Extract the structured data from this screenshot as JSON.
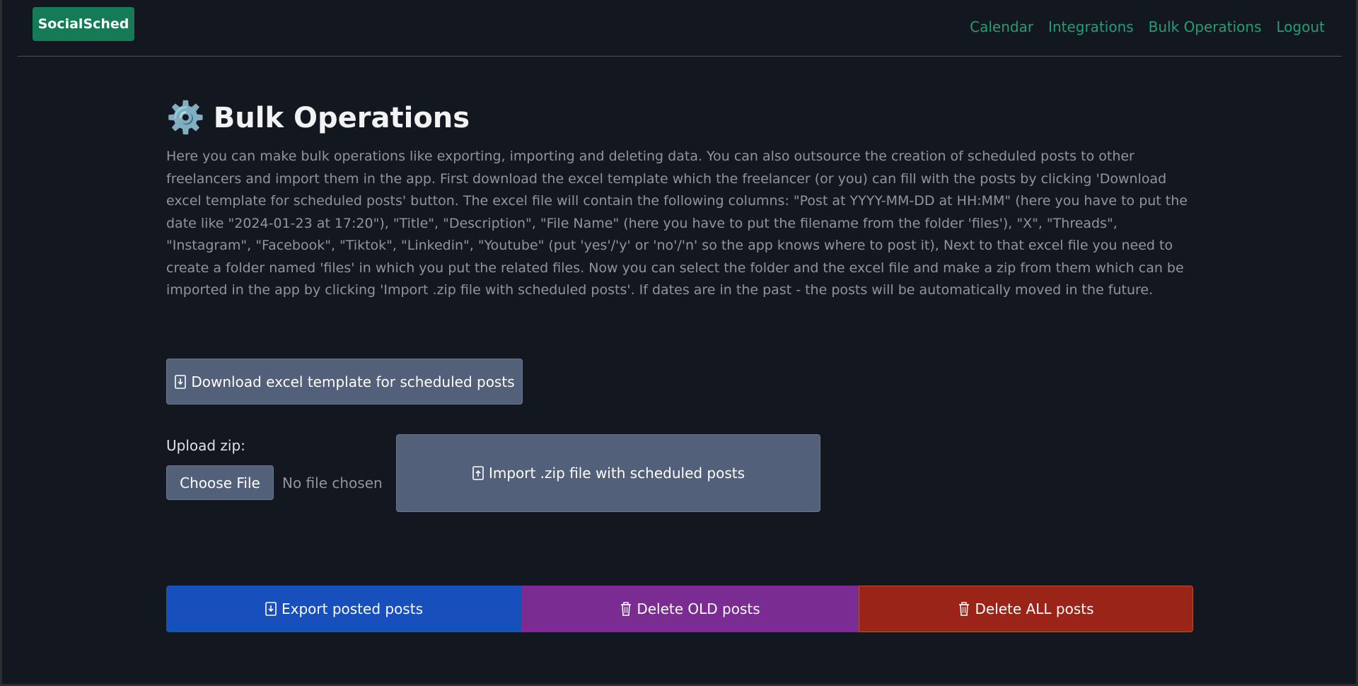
{
  "app": {
    "brand": "SocialSched"
  },
  "nav": {
    "items": [
      "Calendar",
      "Integrations",
      "Bulk Operations",
      "Logout"
    ]
  },
  "page": {
    "icon": "⚙️",
    "title": "Bulk Operations",
    "description": "Here you can make bulk operations like exporting, importing and deleting data. You can also outsource the creation of scheduled posts to other freelancers and import them in the app. First download the excel template which the freelancer (or you) can fill with the posts by clicking 'Download excel template for scheduled posts' button. The excel file will contain the following columns: \"Post at YYYY-MM-DD at HH:MM\" (here you have to put the date like \"2024-01-23 at 17:20\"), \"Title\", \"Description\", \"File Name\" (here you have to put the filename from the folder 'files'), \"X\", \"Threads\", \"Instagram\", \"Facebook\", \"Tiktok\", \"Linkedin\", \"Youtube\" (put 'yes'/'y' or 'no'/'n' so the app knows where to post it), Next to that excel file you need to create a folder named 'files' in which you put the related files. Now you can select the folder and the excel file and make a zip from them which can be imported in the app by clicking 'Import .zip file with scheduled posts'. If dates are in the past - the posts will be automatically moved in the future."
  },
  "actions": {
    "download_template_label": "Download excel template for scheduled posts",
    "upload_label": "Upload zip:",
    "choose_file_label": "Choose File",
    "no_file_text": "No file chosen",
    "import_label": "Import .zip file with scheduled posts",
    "export_label": "Export posted posts",
    "delete_old_label": "Delete OLD posts",
    "delete_all_label": "Delete ALL posts"
  },
  "icons": {
    "download": "download-file-icon",
    "upload": "upload-file-icon",
    "trash": "trash-icon",
    "settings": "gear-icon"
  },
  "colors": {
    "background": "#121720",
    "brand": "#157a56",
    "link": "#20a074",
    "secondary_button": "#536079",
    "export": "#174fbc",
    "delete_old": "#7a2c92",
    "delete_all": "#9b2419"
  }
}
